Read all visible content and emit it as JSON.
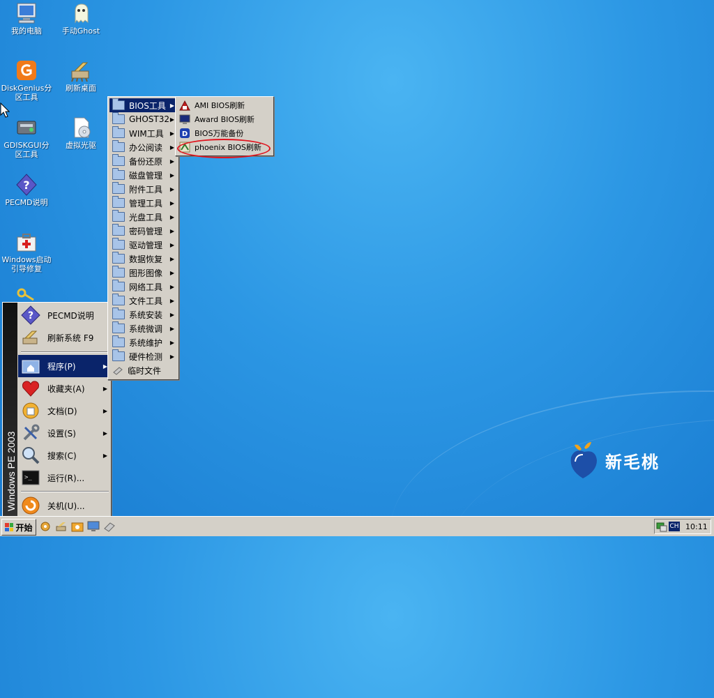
{
  "desktop": {
    "icons": [
      {
        "label": "我的电脑",
        "icon": "computer-icon"
      },
      {
        "label": "手动Ghost",
        "icon": "ghost-icon"
      },
      {
        "label": "DiskGenius分区工具",
        "icon": "diskgenius-icon"
      },
      {
        "label": "刷新桌面",
        "icon": "refresh-desktop-icon"
      },
      {
        "label": "GDISKGUI分区工具",
        "icon": "gdisk-icon"
      },
      {
        "label": "虚拟光驱",
        "icon": "virtual-drive-icon"
      },
      {
        "label": "PECMD说明",
        "icon": "help-icon"
      },
      {
        "label": "Windows启动引导修复",
        "icon": "repair-kit-icon"
      }
    ]
  },
  "start_menu": {
    "banner": "Windows PE 2003",
    "items": [
      {
        "label": "PECMD说明",
        "icon": "help-icon"
      },
      {
        "label": "刷新系统 F9",
        "icon": "refresh-system-icon"
      },
      {
        "label": "程序(P)",
        "icon": "programs-icon"
      },
      {
        "label": "收藏夹(A)",
        "icon": "favorites-icon"
      },
      {
        "label": "文档(D)",
        "icon": "documents-icon"
      },
      {
        "label": "设置(S)",
        "icon": "settings-icon"
      },
      {
        "label": "搜索(C)",
        "icon": "search-icon"
      },
      {
        "label": "运行(R)...",
        "icon": "run-icon"
      },
      {
        "label": "关机(U)...",
        "icon": "shutdown-icon"
      }
    ]
  },
  "programs_menu": {
    "items": [
      "BIOS工具",
      "GHOST32",
      "WIM工具",
      "办公阅读",
      "备份还原",
      "磁盘管理",
      "附件工具",
      "管理工具",
      "光盘工具",
      "密码管理",
      "驱动管理",
      "数据恢复",
      "图形图像",
      "网络工具",
      "文件工具",
      "系统安装",
      "系统微调",
      "系统维护",
      "硬件检测",
      "临时文件"
    ]
  },
  "bios_menu": {
    "items": [
      {
        "label": "AMI BIOS刷新",
        "icon": "ami-icon"
      },
      {
        "label": "Award BIOS刷新",
        "icon": "award-icon"
      },
      {
        "label": "BIOS万能备份",
        "icon": "bios-backup-icon"
      },
      {
        "label": "phoenix BIOS刷新",
        "icon": "phoenix-icon"
      }
    ]
  },
  "logo": {
    "text": "新毛桃"
  },
  "taskbar": {
    "start_label": "开始",
    "tray": {
      "lang": "CH",
      "clock": "10:11"
    }
  },
  "colors": {
    "desktop": "#2c97e4",
    "menu_bg": "#d4d0c8",
    "highlight": "#0a246a",
    "annotation": "#e0141e"
  }
}
